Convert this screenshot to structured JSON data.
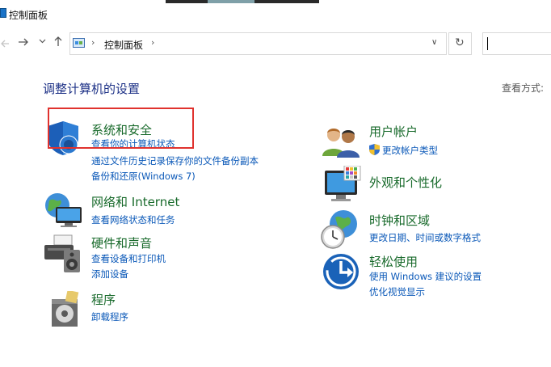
{
  "window": {
    "title": "控制面板"
  },
  "nav": {
    "back_icon": "arrow-left-icon",
    "forward_icon": "arrow-right-icon",
    "recent_icon": "chevron-down-icon",
    "up_icon": "arrow-up-icon",
    "breadcrumb": [
      "控制面板"
    ],
    "separator": "›",
    "dropdown": "∨",
    "refresh": "↻"
  },
  "search": {
    "value": ""
  },
  "header": {
    "title": "调整计算机的设置",
    "view_by": "查看方式:"
  },
  "categories_left": [
    {
      "icon": "shield-icon",
      "title": "系统和安全",
      "links": [
        "查看你的计算机状态",
        "通过文件历史记录保存你的文件备份副本",
        "备份和还原(Windows 7)"
      ]
    },
    {
      "icon": "network-globe-icon",
      "title": "网络和 Internet",
      "links": [
        "查看网络状态和任务"
      ]
    },
    {
      "icon": "printer-speaker-icon",
      "title": "硬件和声音",
      "links": [
        "查看设备和打印机",
        "添加设备"
      ]
    },
    {
      "icon": "programs-disc-icon",
      "title": "程序",
      "links": [
        "卸载程序"
      ]
    }
  ],
  "categories_right": [
    {
      "icon": "user-accounts-icon",
      "title": "用户帐户",
      "links": [
        "更改帐户类型"
      ]
    },
    {
      "icon": "display-palette-icon",
      "title": "外观和个性化",
      "links": []
    },
    {
      "icon": "clock-globe-icon",
      "title": "时钟和区域",
      "links": [
        "更改日期、时间或数字格式"
      ]
    },
    {
      "icon": "ease-of-access-icon",
      "title": "轻松使用",
      "links": [
        "使用 Windows 建议的设置",
        "优化视觉显示"
      ]
    }
  ],
  "colors": {
    "category_title": "#186a2b",
    "link": "#0a58b8",
    "heading": "#1e3287",
    "highlight": "#e0322e"
  }
}
